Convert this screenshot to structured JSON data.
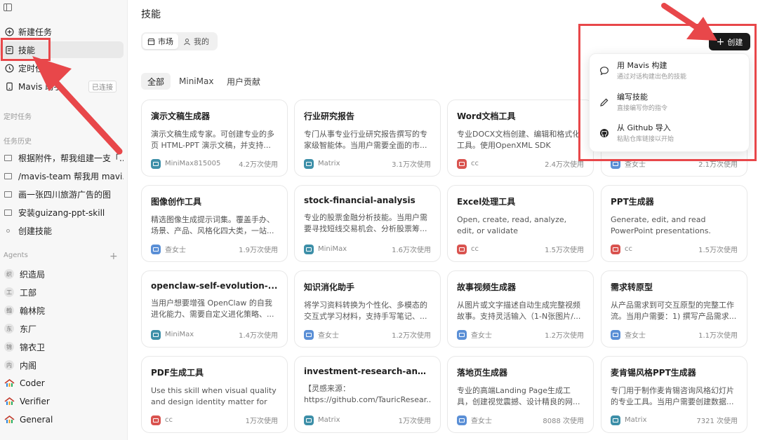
{
  "sidebar": {
    "items": [
      {
        "label": "新建任务",
        "icon": "plus-circle-icon"
      },
      {
        "label": "技能",
        "icon": "skills-icon"
      },
      {
        "label": "定时任务",
        "icon": "clock-icon"
      },
      {
        "label": "Mavis 助手",
        "icon": "mavis-icon",
        "badge": "已连接"
      }
    ],
    "sections": {
      "scheduled": "定时任务",
      "history": "任务历史",
      "agents": "Agents"
    },
    "history": [
      {
        "label": "根据附件，帮我组建一支「..."
      },
      {
        "label": "/mavis-team 帮我用 mavi..."
      },
      {
        "label": "画一张四川旅游广告的图"
      },
      {
        "label": "安装guizang-ppt-skill"
      },
      {
        "label": "创建技能"
      }
    ],
    "agents": [
      {
        "label": "织造局",
        "avatar": "织"
      },
      {
        "label": "工部",
        "avatar": "工"
      },
      {
        "label": "翰林院",
        "avatar": "翰"
      },
      {
        "label": "东厂",
        "avatar": "东"
      },
      {
        "label": "锦衣卫",
        "avatar": "锦"
      },
      {
        "label": "内阁",
        "avatar": "内"
      },
      {
        "label": "Coder",
        "avatar": ""
      },
      {
        "label": "Verifier",
        "avatar": ""
      },
      {
        "label": "General",
        "avatar": ""
      }
    ]
  },
  "header": {
    "title": "技能",
    "segments": [
      {
        "label": "市场"
      },
      {
        "label": "我的"
      }
    ],
    "filters": [
      {
        "label": "全部"
      },
      {
        "label": "MiniMax"
      },
      {
        "label": "用户贡献"
      }
    ],
    "create_label": "创建"
  },
  "dropdown": {
    "items": [
      {
        "title": "用 Mavis 构建",
        "sub": "通过对话构建出色的技能",
        "icon": "chat-icon"
      },
      {
        "title": "编写技能",
        "sub": "直接编写你的指令",
        "icon": "pencil-icon"
      },
      {
        "title": "从 Github 导入",
        "sub": "粘贴仓库链接以开始",
        "icon": "github-icon"
      }
    ]
  },
  "colors": {
    "matrix": "#3d8fa8",
    "cc": "#d9534f",
    "chanvshi": "#5a8fd6",
    "minimax": "#3d8fa8",
    "annotation": "#e8474a"
  },
  "cards": [
    {
      "title": "演示文稿生成器",
      "desc": "演示文稿生成专家。可创建专业的多页 HTML-PPT 演示文稿，并支持...",
      "author": "MiniMax815005",
      "uses": "4.2万次使用",
      "color": "#3d8fa8"
    },
    {
      "title": "行业研究报告",
      "desc": "专门从事专业行业研究报告撰写的专家级智能体。当用户需要全面的市...",
      "author": "Matrix",
      "uses": "3.1万次使用",
      "color": "#3d8fa8"
    },
    {
      "title": "Word文档工具",
      "desc": "专业DOCX文档创建、编辑和格式化工具。使用OpenXML SDK (.NET)...",
      "author": "cc",
      "uses": "2.4万次使用",
      "color": "#d9534f"
    },
    {
      "title": "",
      "desc": "",
      "author": "查女士",
      "uses": "2.1万次使用",
      "color": "#5a8fd6"
    },
    {
      "title": "图像创作工具",
      "desc": "精选图像生成提示词集。覆盖手办、场景、产品、风格化四大类，一站...",
      "author": "查女士",
      "uses": "1.9万次使用",
      "color": "#5a8fd6"
    },
    {
      "title": "stock-financial-analysis",
      "desc": "专业的股票金融分析技能。当用户需要寻找短线交易机会、分析股票筹...",
      "author": "MiniMax",
      "uses": "1.6万次使用",
      "color": "#3d8fa8"
    },
    {
      "title": "Excel处理工具",
      "desc": "Open, create, read, analyze, edit, or validate Excel/spreadsheet fil...",
      "author": "cc",
      "uses": "1.5万次使用",
      "color": "#d9534f"
    },
    {
      "title": "PPT生成器",
      "desc": "Generate, edit, and read PowerPoint presentations. Creat...",
      "author": "cc",
      "uses": "1.5万次使用",
      "color": "#d9534f"
    },
    {
      "title": "openclaw-self-evolution-...",
      "desc": "当用户想要增强 OpenClaw 的自我进化能力、需要自定义进化策略、...",
      "author": "MiniMax",
      "uses": "1.4万次使用",
      "color": "#3d8fa8"
    },
    {
      "title": "知识消化助手",
      "desc": "将学习资料转换为个性化、多模态的交互式学习材料，支持手写笔记、...",
      "author": "查女士",
      "uses": "1.2万次使用",
      "color": "#5a8fd6"
    },
    {
      "title": "故事视频生成器",
      "desc": "从图片或文字描述自动生成完整视频故事。支持灵活输入（1-N张图片/...",
      "author": "查女士",
      "uses": "1.2万次使用",
      "color": "#5a8fd6"
    },
    {
      "title": "需求转原型",
      "desc": "从产品需求到可交互原型的完整工作流。当用户需要：1) 撰写产品需求...",
      "author": "查女士",
      "uses": "1.1万次使用",
      "color": "#5a8fd6"
    },
    {
      "title": "PDF生成工具",
      "desc": "Use this skill when visual quality and design identity matter for a...",
      "author": "cc",
      "uses": "1万次使用",
      "color": "#d9534f"
    },
    {
      "title": "investment-research-anal...",
      "desc": "【灵感来源：https://github.com/TauricResear...",
      "author": "Matrix",
      "uses": "1万次使用",
      "color": "#3d8fa8"
    },
    {
      "title": "落地页生成器",
      "desc": "专业的高端Landing Page生成工具，创建视觉震撼、设计精良的网...",
      "author": "查女士",
      "uses": "8088 次使用",
      "color": "#5a8fd6"
    },
    {
      "title": "麦肯锡风格PPT生成器",
      "desc": "专门用于制作麦肯锡咨询风格幻灯片的专业工具。当用户需要创建数据...",
      "author": "Matrix",
      "uses": "7321 次使用",
      "color": "#3d8fa8"
    }
  ]
}
